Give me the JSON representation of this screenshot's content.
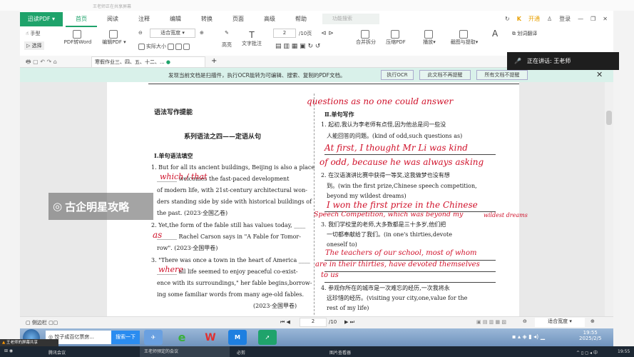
{
  "top_caption": "王老师正在共享屏幕",
  "app": {
    "logo": "迅读PDF",
    "menu": [
      "首页",
      "阅读",
      "注释",
      "编辑",
      "转换",
      "页面",
      "高级",
      "帮助"
    ],
    "search_placeholder": "功能搜索",
    "upgrade": "开通",
    "login": "登录"
  },
  "toolbar": {
    "hand": "手型",
    "select": "选择",
    "pdf_to_word": "PDF转Word",
    "edit_pdf": "编辑PDF",
    "zoom_mode": "适合宽度",
    "actual_size": "实际大小",
    "highlight": "高亮",
    "text_note": "文字批注",
    "page_current": "2",
    "page_total": "/10页",
    "merge_split": "合并拆分",
    "compress": "压缩PDF",
    "play": "播放",
    "screenshot": "截图与提取",
    "translate": "划词翻译"
  },
  "speaking": {
    "label": "正在讲话: 王老师"
  },
  "tabs": {
    "doc": "寒假作业三、四、五、十二、..."
  },
  "page_badge": "1",
  "banner": {
    "text": "发现当前文档是扫描件，执行OCR能转为可编辑、搜索、复制的PDF文档。",
    "ocr": "执行OCR",
    "no_remind": "此文档不再提醒",
    "no_remind_all": "所有文档不提醒"
  },
  "doc": {
    "section": "语法写作提能",
    "title": "系列语法之四——定语从句",
    "part1": "Ⅰ.单句语法填空",
    "left_lines": [
      "1. But for all its ancient buildings, Beijing is also a place",
      "_______ welcomes the fast-paced development",
      "of modern life, with 21st-century architectural won-",
      "ders standing side by side with historical buildings of",
      "the past.                              (2023·全国乙卷)",
      "2. Yet,the form of the fable still has values today, ____",
      "_______ Rachel Carson says in \"A Fable for Tomor-",
      "row\".                                  (2023·全国甲卷)",
      "3. \"There was once a town in the heart of America ____",
      "_______ all life seemed to enjoy peaceful co-exist-",
      "ence with its surroundings,\" her fable begins,borrow-",
      "ing some familiar words from many age-old fables.",
      "(2023·全国甲卷)"
    ],
    "part2": "Ⅱ.单句写作",
    "right_lines": [
      "1. 起初,我认为李老师有点怪,因为他总是问一些没",
      "人能回答的问题。(kind of odd,such questions as)",
      "2. 在汉语演讲比赛中获得一等奖,这我做梦也没有想",
      "到。(win the first prize,Chinese speech competition,",
      "beyond my wildest dreams)",
      "3. 我们学校里的老师,大多数都是三十多岁,他们把",
      "一切都奉献给了我们。(in one's thirties,devote",
      "oneself to)",
      "4. 参观你所在的城市是一次难忘的经历,一次我将永",
      "远珍惜的经历。(visiting your city,one,value for the",
      "rest of my life)"
    ],
    "handwriting": [
      "questions as no one could answer",
      "which / that",
      "as",
      "where",
      "At first, I thought Mr Li was kind",
      "of odd, because he was always asking",
      "I won the first prize in the Chinese",
      "Speech Competition, which was beyond my",
      "wildest dreams",
      "The teachers of our school, most of whom",
      "are in their thirties, have devoted themselves",
      "to us"
    ]
  },
  "watermark": "古企明星攻略",
  "status": {
    "sidebar": "侧边栏",
    "page": "2",
    "total": "/10",
    "zoom": "适合宽度"
  },
  "taskbar": {
    "news": "饺子成百亿票房...",
    "search_btn": "搜索一下",
    "time": "19:55",
    "date": "2025/2/5"
  },
  "bottom_bar": {
    "sharing": "王老师的屏幕共享",
    "items": [
      "腾讯会议",
      "王老师预定的会议",
      "必剪",
      "图片查看器"
    ],
    "time": "19:55"
  }
}
